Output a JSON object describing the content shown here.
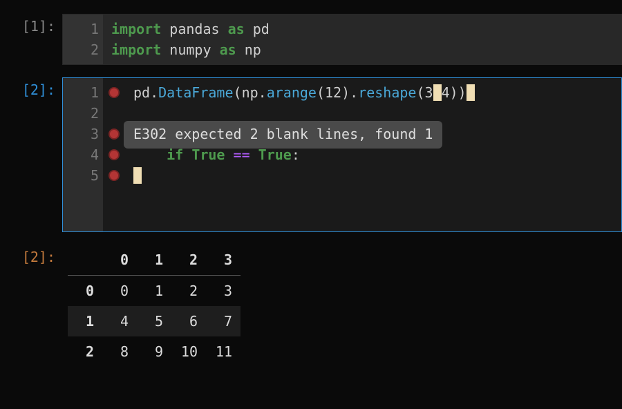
{
  "cells": [
    {
      "prompt": "[1]:",
      "lines": [
        "1",
        "2"
      ],
      "tokens": {
        "import1": "import",
        "pandas": "pandas",
        "as1": "as",
        "pd": "pd",
        "import2": "import",
        "numpy": "numpy",
        "as2": "as",
        "np": "np"
      }
    },
    {
      "prompt": "[2]:",
      "lines": [
        "1",
        "2",
        "3",
        "4",
        "5"
      ],
      "markers": [
        true,
        false,
        true,
        true,
        true
      ],
      "lint": "E302 expected 2 blank lines, found 1",
      "code": {
        "l1_pd": "pd",
        "l1_dot1": ".",
        "l1_DataFrame": "DataFrame",
        "l1_lp1": "(",
        "l1_np": "np",
        "l1_dot2": ".",
        "l1_arange": "arange",
        "l1_lp2": "(",
        "l1_12": "12",
        "l1_rp2": ")",
        "l1_dot3": ".",
        "l1_reshape": "reshape",
        "l1_lp3": "(",
        "l1_3": "3",
        "l1_4": "4",
        "l1_rp3": ")",
        "l1_rp1": ")",
        "l4_if": "if",
        "l4_true1": "True",
        "l4_eq": "==",
        "l4_true2": "True",
        "l4_colon": ":"
      }
    },
    {
      "prompt": "[2]:",
      "table": {
        "columns": [
          "0",
          "1",
          "2",
          "3"
        ],
        "index": [
          "0",
          "1",
          "2"
        ],
        "rows": [
          [
            "0",
            "1",
            "2",
            "3"
          ],
          [
            "4",
            "5",
            "6",
            "7"
          ],
          [
            "8",
            "9",
            "10",
            "11"
          ]
        ]
      }
    }
  ],
  "chart_data": {
    "type": "table",
    "title": "",
    "columns": [
      "0",
      "1",
      "2",
      "3"
    ],
    "index": [
      "0",
      "1",
      "2"
    ],
    "data": [
      [
        0,
        1,
        2,
        3
      ],
      [
        4,
        5,
        6,
        7
      ],
      [
        8,
        9,
        10,
        11
      ]
    ]
  }
}
